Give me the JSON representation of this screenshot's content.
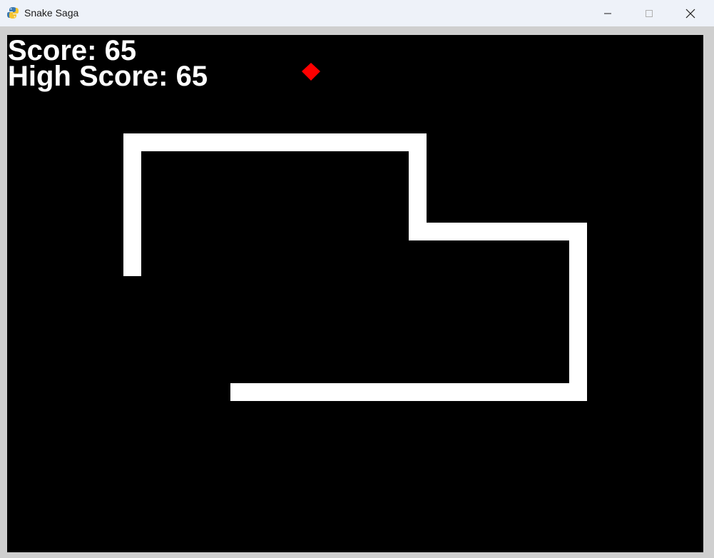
{
  "window": {
    "title": "Snake Saga",
    "controls": [
      "minimize",
      "maximize",
      "close"
    ]
  },
  "hud": {
    "score_label": "Score:",
    "score_value": "65",
    "high_score_label": "High Score:",
    "high_score_value": "65"
  },
  "game": {
    "background_color": "#000000",
    "snake_color": "#ffffff",
    "food_color": "#ff0000",
    "food_shape": "diamond"
  },
  "icons": {
    "app": "python-snake-icon",
    "minimize": "minimize-icon",
    "maximize": "maximize-icon",
    "close": "close-icon"
  }
}
